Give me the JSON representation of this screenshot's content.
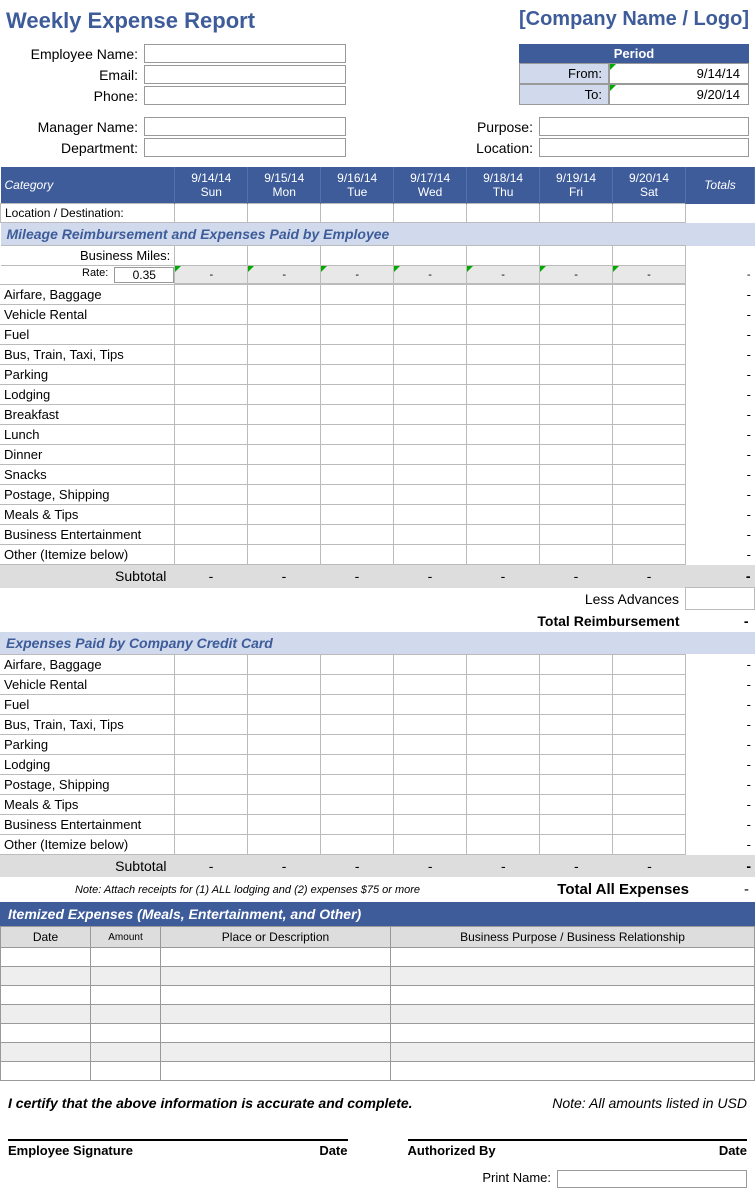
{
  "title": "Weekly Expense Report",
  "company": "[Company Name / Logo]",
  "employee": {
    "name_label": "Employee Name:",
    "email_label": "Email:",
    "phone_label": "Phone:",
    "manager_label": "Manager Name:",
    "dept_label": "Department:"
  },
  "period": {
    "header": "Period",
    "from_label": "From:",
    "from_value": "9/14/14",
    "to_label": "To:",
    "to_value": "9/20/14"
  },
  "purpose": {
    "purpose_label": "Purpose:",
    "location_label": "Location:"
  },
  "columns": {
    "category": "Category",
    "totals": "Totals",
    "days": [
      {
        "date": "9/14/14",
        "day": "Sun"
      },
      {
        "date": "9/15/14",
        "day": "Mon"
      },
      {
        "date": "9/16/14",
        "day": "Tue"
      },
      {
        "date": "9/17/14",
        "day": "Wed"
      },
      {
        "date": "9/18/14",
        "day": "Thu"
      },
      {
        "date": "9/19/14",
        "day": "Fri"
      },
      {
        "date": "9/20/14",
        "day": "Sat"
      }
    ]
  },
  "location_row": "Location / Destination:",
  "section1": {
    "header": "Mileage Reimbursement and Expenses Paid by Employee",
    "miles_label": "Business Miles:",
    "rate_label": "Rate:",
    "rate_value": "0.35",
    "dash": "-",
    "rows": [
      "Airfare, Baggage",
      "Vehicle Rental",
      "Fuel",
      "Bus, Train, Taxi, Tips",
      "Parking",
      "Lodging",
      "Breakfast",
      "Lunch",
      "Dinner",
      "Snacks",
      "Postage, Shipping",
      "Meals & Tips",
      "Business Entertainment",
      "Other (Itemize below)"
    ],
    "subtotal": "Subtotal",
    "less_advances": "Less Advances",
    "total_reimb": "Total Reimbursement"
  },
  "section2": {
    "header": "Expenses Paid by Company Credit Card",
    "rows": [
      "Airfare, Baggage",
      "Vehicle Rental",
      "Fuel",
      "Bus, Train, Taxi, Tips",
      "Parking",
      "Lodging",
      "Postage, Shipping",
      "Meals & Tips",
      "Business Entertainment",
      "Other (Itemize below)"
    ],
    "subtotal": "Subtotal"
  },
  "note": "Note:  Attach receipts for (1) ALL lodging and (2) expenses $75 or more",
  "total_all": "Total All Expenses",
  "total_all_val": "-",
  "itemized": {
    "header": "Itemized Expenses (Meals, Entertainment, and Other)",
    "cols": {
      "date": "Date",
      "amount": "Amount",
      "place": "Place or Description",
      "purpose": "Business Purpose / Business Relationship"
    }
  },
  "cert": "I certify that the above information is accurate and complete.",
  "currency_note": "Note: All amounts listed in USD",
  "sig": {
    "emp": "Employee Signature",
    "auth": "Authorized By",
    "date": "Date",
    "print": "Print Name:"
  }
}
